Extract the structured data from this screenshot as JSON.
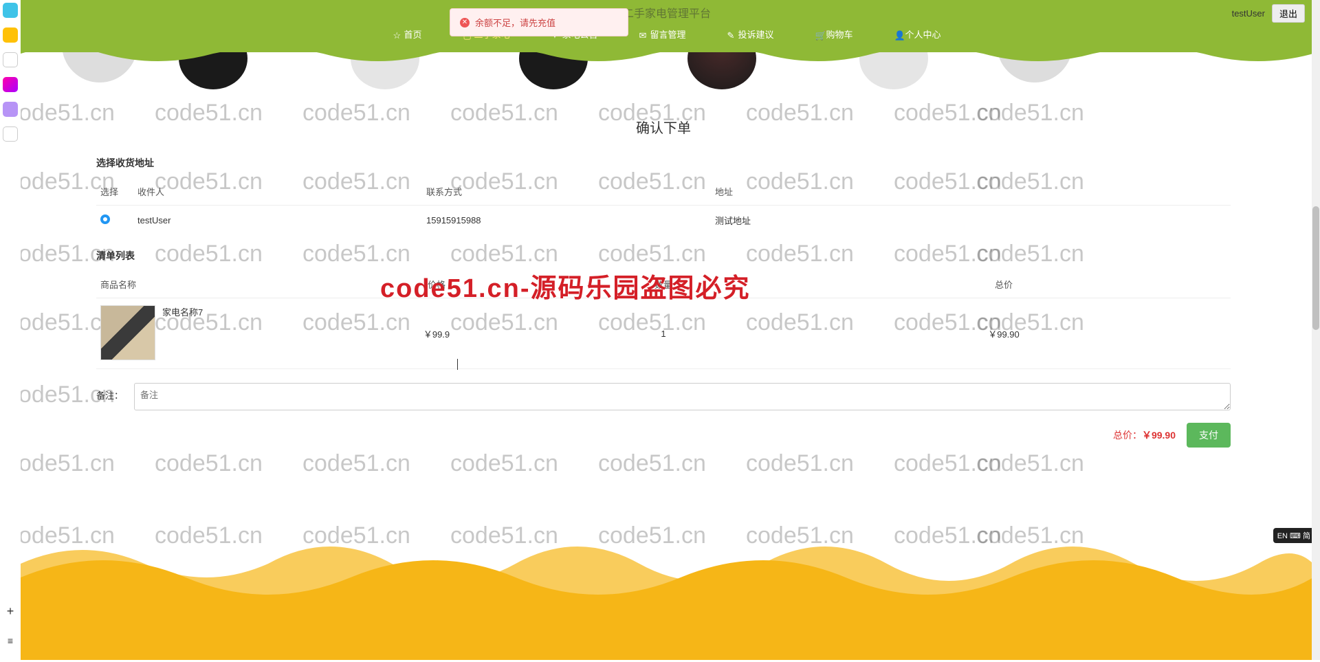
{
  "header": {
    "title": "二手家电管理平台",
    "username": "testUser",
    "logout": "退出"
  },
  "nav": [
    {
      "label": "首页",
      "active": false
    },
    {
      "label": "二手家电",
      "active": true
    },
    {
      "label": "家电公告",
      "active": false
    },
    {
      "label": "留言管理",
      "active": false
    },
    {
      "label": "投诉建议",
      "active": false
    },
    {
      "label": "购物车",
      "active": false
    },
    {
      "label": "个人中心",
      "active": false
    }
  ],
  "alert": {
    "text": "余额不足，请先充值"
  },
  "section_confirm": "确认下单",
  "address": {
    "heading": "选择收货地址",
    "cols": {
      "select": "选择",
      "name": "收件人",
      "phone": "联系方式",
      "addr": "地址"
    },
    "rows": [
      {
        "name": "testUser",
        "phone": "15915915988",
        "addr": "测试地址",
        "selected": true
      }
    ]
  },
  "items": {
    "heading": "清单列表",
    "cols": {
      "name": "商品名称",
      "price": "价格",
      "qty": "数量",
      "total": "总价"
    },
    "rows": [
      {
        "name": "家电名称7",
        "price": "￥99.9",
        "qty": "1",
        "total": "￥99.90"
      }
    ]
  },
  "remark": {
    "label": "备注：",
    "placeholder": "备注"
  },
  "summary": {
    "label": "总价：",
    "value": "￥99.90",
    "pay": "支付"
  },
  "watermark": "code51.cn",
  "overlay": "code51.cn-源码乐园盗图必究",
  "ime": "EN ⌨ 简",
  "dock_colors": [
    "#3fc3e8",
    "#ffc107",
    "#333",
    "#e879d8",
    "#7b5cff",
    "#8b5cf6"
  ]
}
